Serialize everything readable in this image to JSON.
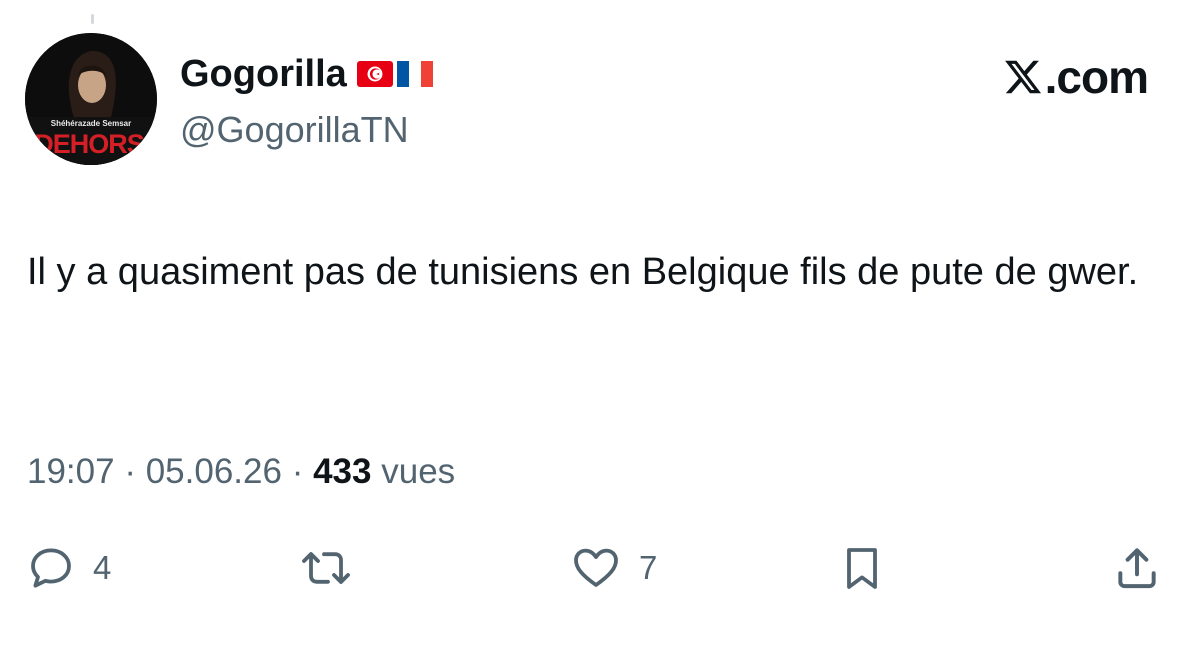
{
  "tweet": {
    "display_name": "Gogorilla",
    "flags": [
      "tunisia-flag",
      "france-flag"
    ],
    "handle": "@GogorillaTN",
    "avatar": {
      "caption_small": "Shéhérazade Semsar",
      "caption_large": "DEHORS"
    },
    "text": "Il y a quasiment pas de tunisiens en Belgique fils de pute de gwer.",
    "time": "19:07",
    "date": "05.06.26",
    "separator": "·",
    "views_count": "433",
    "views_label": "vues"
  },
  "brand": {
    "label": ".com",
    "icon": "x-logo-icon"
  },
  "actions": {
    "reply_count": "4",
    "like_count": "7"
  },
  "colors": {
    "text": "#0f1419",
    "secondary": "#536471",
    "tunisia_red": "#e70013",
    "france_blue": "#0055a4",
    "france_red": "#ef4135"
  }
}
